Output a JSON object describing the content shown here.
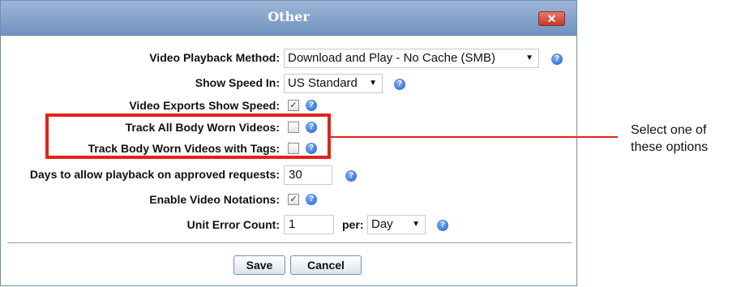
{
  "dialog": {
    "title": "Other",
    "close_glyph": "✕",
    "help_glyph": "?",
    "check_glyph": "✓",
    "fields": {
      "playback_method": {
        "label": "Video Playback Method:",
        "value": "Download and Play - No Cache (SMB)"
      },
      "show_speed_in": {
        "label": "Show Speed In:",
        "value": "US Standard"
      },
      "exports_show_speed": {
        "label": "Video Exports Show Speed:",
        "checked": true
      },
      "track_all_bwv": {
        "label": "Track All Body Worn Videos:",
        "checked": false
      },
      "track_bwv_tags": {
        "label": "Track Body Worn Videos with Tags:",
        "checked": false
      },
      "days_playback": {
        "label": "Days to allow playback on approved requests:",
        "value": "30"
      },
      "enable_notations": {
        "label": "Enable Video Notations:",
        "checked": true
      },
      "unit_error_count": {
        "label": "Unit Error Count:",
        "value": "1",
        "per_label": "per:",
        "per_value": "Day"
      }
    },
    "buttons": {
      "save": "Save",
      "cancel": "Cancel"
    }
  },
  "annotation": {
    "line1": "Select one of",
    "line2": "these options",
    "color": "#e2231a"
  },
  "colors": {
    "titlebar": "#7e9dc7",
    "close": "#d6483c",
    "help": "#2f6fd6"
  }
}
